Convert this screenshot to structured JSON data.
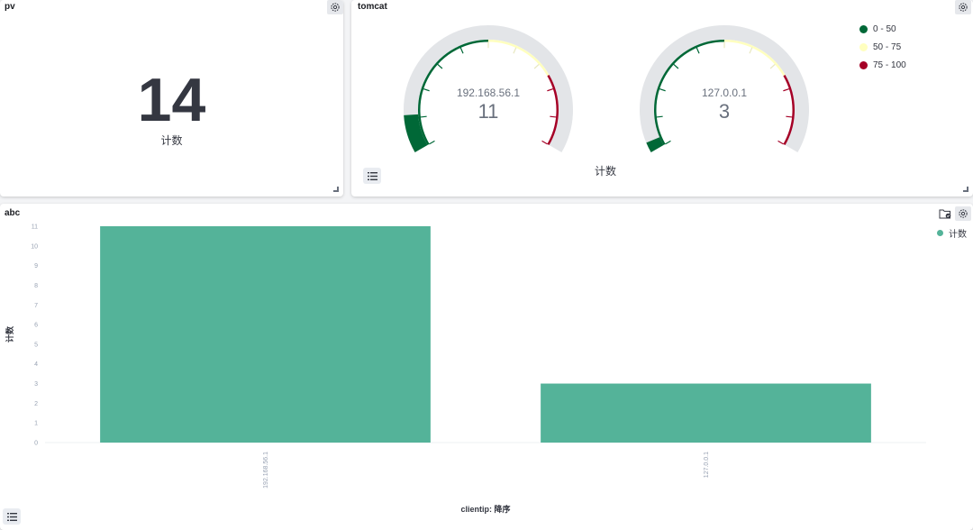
{
  "panels": {
    "pv": {
      "title": "pv",
      "value": "14",
      "label": "计数"
    },
    "tomcat": {
      "title": "tomcat",
      "label": "计数",
      "max": 100,
      "gauges": [
        {
          "name": "192.168.56.1",
          "value_label": "11",
          "value": 11
        },
        {
          "name": "127.0.0.1",
          "value_label": "3",
          "value": 3
        }
      ],
      "legend": [
        {
          "label": "0 - 50",
          "color": "#006837"
        },
        {
          "label": "50 - 75",
          "color": "#ffffbf"
        },
        {
          "label": "75 - 100",
          "color": "#a50026"
        }
      ]
    },
    "abc": {
      "title": "abc",
      "legend_label": "计数",
      "legend_color": "#54b399"
    }
  },
  "chart_data": {
    "type": "bar",
    "categories": [
      "192.168.56.1",
      "127.0.0.1"
    ],
    "values": [
      11,
      3
    ],
    "xlabel": "clientip: 降序",
    "ylabel": "计数",
    "ylim": [
      0,
      11
    ],
    "yticks": [
      0,
      1,
      2,
      3,
      4,
      5,
      6,
      7,
      8,
      9,
      10,
      11
    ],
    "grid": false,
    "legend": "top-right",
    "color": "#54b399"
  },
  "icons": {
    "settings": "gear-icon",
    "legend_toggle": "list-icon",
    "resize": "resize-handle-icon",
    "inspect": "folder-check-icon"
  }
}
